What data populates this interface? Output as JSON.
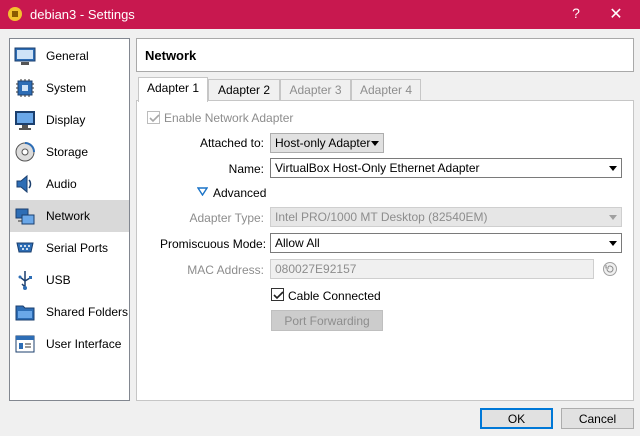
{
  "window": {
    "title": "debian3 - Settings",
    "help": "?",
    "close": "✕"
  },
  "sidebar": {
    "items": [
      {
        "label": "General",
        "icon": "general-icon"
      },
      {
        "label": "System",
        "icon": "system-icon"
      },
      {
        "label": "Display",
        "icon": "display-icon"
      },
      {
        "label": "Storage",
        "icon": "storage-icon"
      },
      {
        "label": "Audio",
        "icon": "audio-icon"
      },
      {
        "label": "Network",
        "icon": "network-icon",
        "selected": true
      },
      {
        "label": "Serial Ports",
        "icon": "serial-ports-icon"
      },
      {
        "label": "USB",
        "icon": "usb-icon"
      },
      {
        "label": "Shared Folders",
        "icon": "shared-folders-icon"
      },
      {
        "label": "User Interface",
        "icon": "user-interface-icon"
      }
    ]
  },
  "page": {
    "title": "Network"
  },
  "tabs": [
    {
      "label": "Adapter 1",
      "active": true
    },
    {
      "label": "Adapter 2"
    },
    {
      "label": "Adapter 3",
      "disabled": true
    },
    {
      "label": "Adapter 4",
      "disabled": true
    }
  ],
  "adapter": {
    "enable_label": "Enable Network Adapter",
    "enable_checked": true,
    "attached_label": "Attached to:",
    "attached_value": "Host-only Adapter",
    "name_label": "Name:",
    "name_value": "VirtualBox Host-Only Ethernet Adapter",
    "advanced_label": "Advanced",
    "type_label": "Adapter Type:",
    "type_value": "Intel PRO/1000 MT Desktop (82540EM)",
    "promisc_label": "Promiscuous Mode:",
    "promisc_value": "Allow All",
    "mac_label": "MAC Address:",
    "mac_value": "080027E92157",
    "cable_label": "Cable Connected",
    "cable_checked": true,
    "port_forwarding_label": "Port Forwarding"
  },
  "buttons": {
    "ok": "OK",
    "cancel": "Cancel"
  },
  "colors": {
    "titlebar": "#c8184f",
    "selection": "#d9d9d9",
    "accent": "#0078d7"
  }
}
